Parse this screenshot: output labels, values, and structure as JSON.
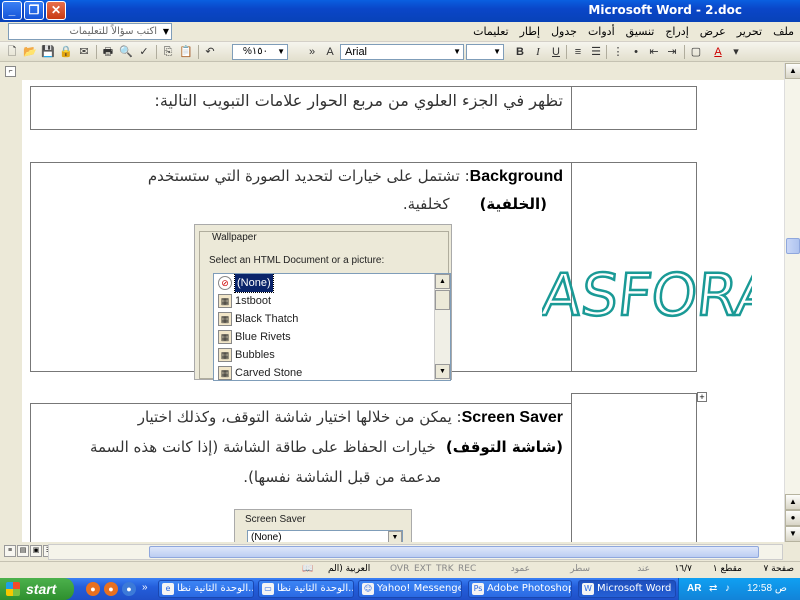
{
  "window": {
    "title": "Microsoft Word - 2.doc",
    "min": "_",
    "max": "❐",
    "close": "✕"
  },
  "menu": {
    "items": [
      "ملف",
      "تحرير",
      "عرض",
      "إدراج",
      "تنسيق",
      "أدوات",
      "جدول",
      "إطار",
      "تعليمات"
    ],
    "help_placeholder": "اكتب سؤالاً للتعليمات"
  },
  "toolbar": {
    "zoom": "%١٥٠",
    "font": "Arial",
    "size": "",
    "bold": "B",
    "italic": "I",
    "underline": "U"
  },
  "document": {
    "row1_text": "تظهر في الجزء العلوي من مربع الحوار علامات التبويب التالية:",
    "row2": {
      "term": "Background",
      "line1": ": تشتمل على خيارات لتحديد الصورة التي ستستخدم",
      "arabic_term": "(الخلفية)",
      "line2": "كخلفية."
    },
    "wallpaper": {
      "legend": "Wallpaper",
      "label": "Select an HTML Document or a picture:",
      "items": [
        "(None)",
        "1stboot",
        "Black Thatch",
        "Blue Rivets",
        "Bubbles",
        "Carved Stone"
      ]
    },
    "watermark": "ASFORA",
    "row3": {
      "term": "Screen Saver",
      "line1": ": يمكن من خلالها اختيار شاشة التوقف، وكذلك اختيار",
      "arabic_term": "(شاشة التوقف)",
      "line2": "خيارات الحفاظ على طاقة الشاشة (إذا كانت هذه السمة",
      "line3": "مدعمة من قبل الشاشة نفسها)."
    },
    "screensaver": {
      "legend": "Screen Saver",
      "value": "(None)"
    }
  },
  "status": {
    "page": "صفحة ٧",
    "section": "مقطع ١",
    "pages": "١٦/٧",
    "at": "عند",
    "line": "سطر",
    "col": "عمود",
    "rec": "REC",
    "trk": "TRK",
    "ext": "EXT",
    "ovr": "OVR",
    "lang": "العربية (الم"
  },
  "taskbar": {
    "start": "start",
    "tasks": [
      "الوحدة الثانية نظا...",
      "الوحدة الثانية نظا...",
      "Yahoo! Messenger",
      "Adobe Photoshop",
      "Microsoft Word ..."
    ],
    "lang": "AR",
    "clock": "12:58 ص"
  }
}
